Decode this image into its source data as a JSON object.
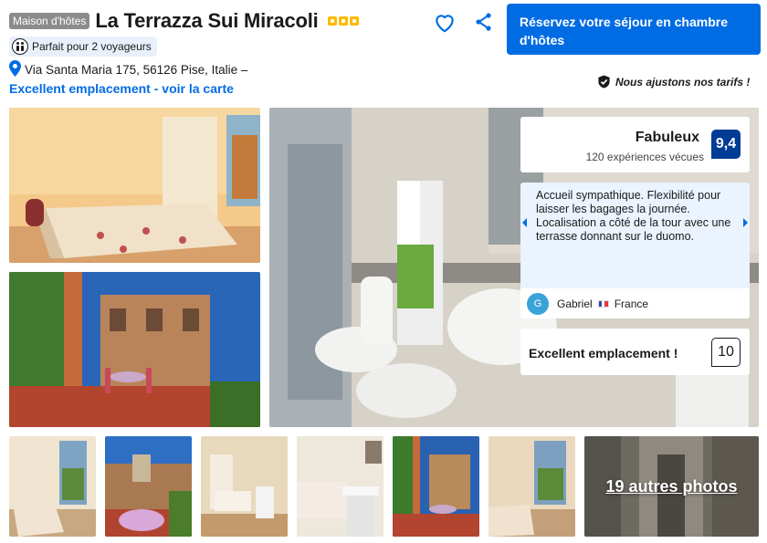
{
  "header": {
    "type_badge": "Maison d'hôtes",
    "name": "La Terrazza Sui Miracoli",
    "star_count": 3,
    "travelers": "Parfait pour 2 voyageurs",
    "address": "Via Santa Maria 175, 56126 Pise, Italie –",
    "location_link": "Excellent emplacement - voir la carte"
  },
  "actions": {
    "heart_icon": "heart-outline-icon",
    "share_icon": "share-icon",
    "book_button": "Réservez votre séjour en chambre d'hôtes",
    "price_match": "Nous ajustons nos tarifs !"
  },
  "rating": {
    "label": "Fabuleux",
    "reviews": "120 expériences vécues",
    "score": "9,4"
  },
  "review": {
    "text": "Accueil sympathique. Flexibilité pour laisser les bagages la journée. Localisation a côté de la tour avec une terrasse donnant sur le duomo.",
    "author_initial": "G",
    "author": "Gabriel",
    "country": "France"
  },
  "location_score": {
    "label": "Excellent emplacement !",
    "score": "10"
  },
  "gallery": {
    "more_photos": "19 autres photos"
  },
  "colors": {
    "brand_blue": "#006ce4",
    "score_navy": "#003b95",
    "star_yellow": "#febb02",
    "review_bg": "#ebf3ff"
  }
}
